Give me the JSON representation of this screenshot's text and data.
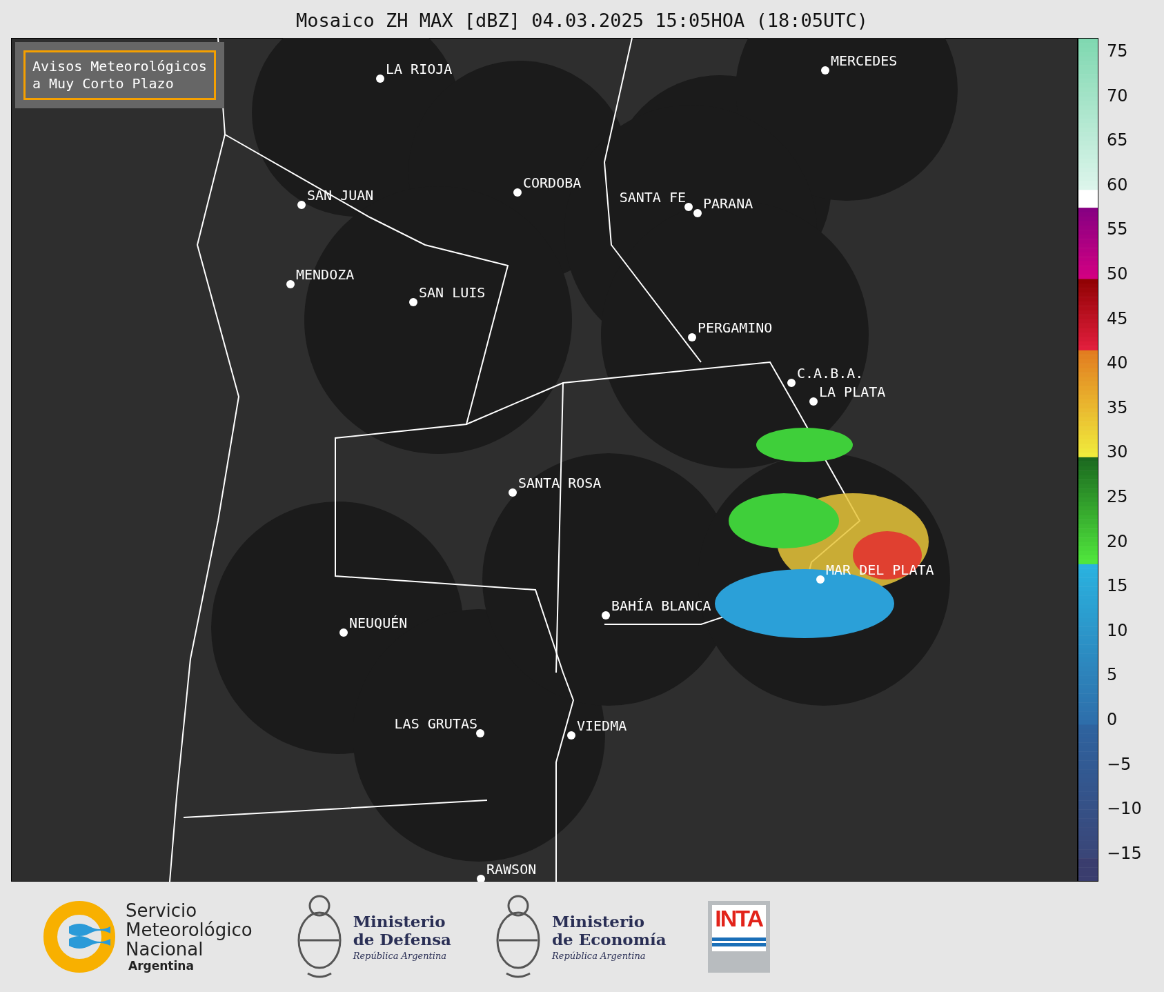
{
  "title": "Mosaico ZH MAX [dBZ] 04.03.2025 15:05HOA (18:05UTC)",
  "notice": "Avisos Meteorológicos\na Muy Corto Plazo",
  "cities": [
    {
      "name": "LA RIOJA"
    },
    {
      "name": "MERCEDES"
    },
    {
      "name": "SAN JUAN"
    },
    {
      "name": "CORDOBA"
    },
    {
      "name": "SANTA FE"
    },
    {
      "name": "PARANA"
    },
    {
      "name": "MENDOZA"
    },
    {
      "name": "SAN LUIS"
    },
    {
      "name": "PERGAMINO"
    },
    {
      "name": "C.A.B.A."
    },
    {
      "name": "LA PLATA"
    },
    {
      "name": "SANTA ROSA"
    },
    {
      "name": "MAR DEL PLATA"
    },
    {
      "name": "BAHÍA BLANCA"
    },
    {
      "name": "NEUQUÉN"
    },
    {
      "name": "LAS GRUTAS"
    },
    {
      "name": "VIEDMA"
    },
    {
      "name": "RAWSON"
    }
  ],
  "colorbar": {
    "ticks": [
      "75",
      "70",
      "65",
      "60",
      "55",
      "50",
      "45",
      "40",
      "35",
      "30",
      "25",
      "20",
      "15",
      "10",
      "5",
      "0",
      "−5",
      "−10",
      "−15"
    ]
  },
  "footer": {
    "smn": {
      "lines": [
        "Servicio",
        "Meteorológico",
        "Nacional"
      ],
      "country": "Argentina"
    },
    "ministries": [
      {
        "title": "Ministerio",
        "subtitle": "de Defensa",
        "country": "República Argentina"
      },
      {
        "title": "Ministerio",
        "subtitle": "de Economía",
        "country": "República Argentina"
      }
    ],
    "inta": "INTA"
  }
}
